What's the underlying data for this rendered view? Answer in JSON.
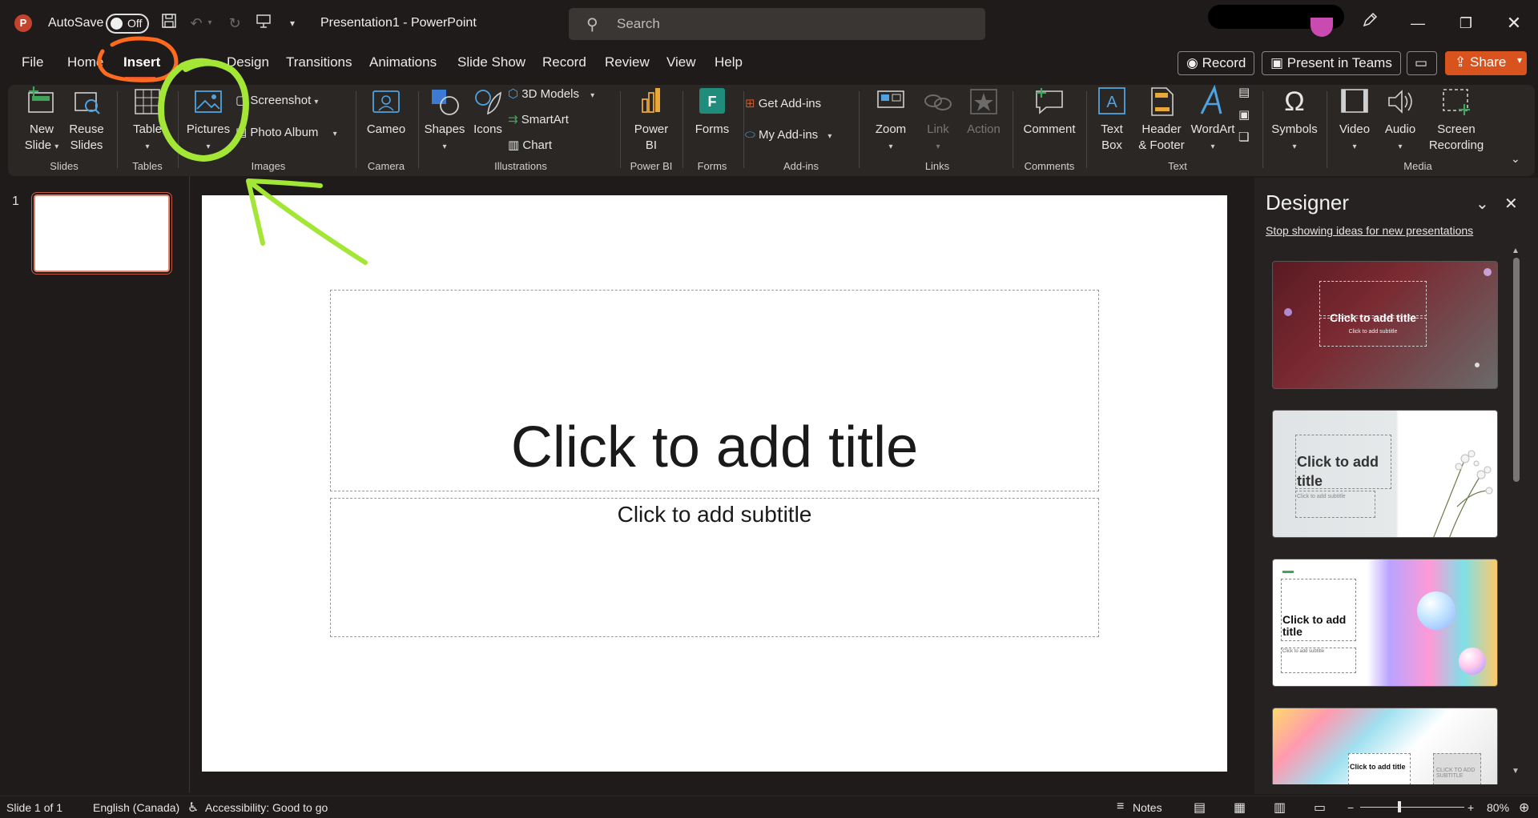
{
  "app": {
    "logo_letter": "P",
    "autosave_label": "AutoSave",
    "autosave_state": "Off",
    "document_title": "Presentation1  -  PowerPoint",
    "search_placeholder": "Search"
  },
  "menu": {
    "tabs": [
      "File",
      "Home",
      "Insert",
      "Design",
      "Transitions",
      "Animations",
      "Slide Show",
      "Record",
      "Review",
      "View",
      "Help"
    ],
    "active_tab": "Insert",
    "record_button": "Record",
    "present_button": "Present in Teams",
    "share_button": "Share"
  },
  "ribbon": {
    "slides": {
      "new_slide": [
        "New",
        "Slide"
      ],
      "reuse_slides": [
        "Reuse",
        "Slides"
      ],
      "label": "Slides"
    },
    "tables": {
      "table": "Table",
      "label": "Tables"
    },
    "images": {
      "pictures": "Pictures",
      "screenshot": "Screenshot",
      "photo_album": "Photo Album",
      "label": "Images"
    },
    "camera": {
      "cameo": "Cameo",
      "label": "Camera"
    },
    "illustrations": {
      "shapes": "Shapes",
      "icons": "Icons",
      "models_3d": "3D Models",
      "smartart": "SmartArt",
      "chart": "Chart",
      "label": "Illustrations"
    },
    "powerbi": {
      "power_bi": [
        "Power",
        "BI"
      ],
      "label": "Power BI"
    },
    "forms": {
      "forms": "Forms",
      "label": "Forms"
    },
    "addins": {
      "get_addins": "Get Add-ins",
      "my_addins": "My Add-ins",
      "label": "Add-ins"
    },
    "links": {
      "zoom": "Zoom",
      "link": "Link",
      "action": "Action",
      "label": "Links"
    },
    "comments": {
      "comment": "Comment",
      "label": "Comments"
    },
    "text": {
      "text_box": [
        "Text",
        "Box"
      ],
      "header_footer": [
        "Header",
        "& Footer"
      ],
      "wordart": "WordArt",
      "label": "Text"
    },
    "symbols": {
      "symbols": "Symbols"
    },
    "media": {
      "video": "Video",
      "audio": "Audio",
      "screen_recording": [
        "Screen",
        "Recording"
      ],
      "label": "Media"
    }
  },
  "slides_panel": {
    "slide_number": "1"
  },
  "slide": {
    "title_placeholder": "Click to add title",
    "subtitle_placeholder": "Click to add subtitle"
  },
  "designer": {
    "title": "Designer",
    "stop_link": "Stop showing ideas for new presentations",
    "cards": [
      {
        "title": "Click to add title",
        "subtitle": "Click to add subtitle"
      },
      {
        "title": "Click to add title",
        "subtitle": "Click to add subtitle"
      },
      {
        "title": "Click to add title",
        "subtitle": "Click to add subtitle"
      },
      {
        "title": "Click to add title",
        "subtitle": "CLICK TO ADD SUBTITLE"
      }
    ]
  },
  "status": {
    "slide_info": "Slide 1 of 1",
    "language": "English (Canada)",
    "accessibility": "Accessibility: Good to go",
    "notes": "Notes",
    "zoom": "80%"
  },
  "colors": {
    "accent": "#e4533b",
    "share": "#d9531e",
    "annotation_orange": "#ff6a1f",
    "annotation_green": "#a3e635"
  }
}
